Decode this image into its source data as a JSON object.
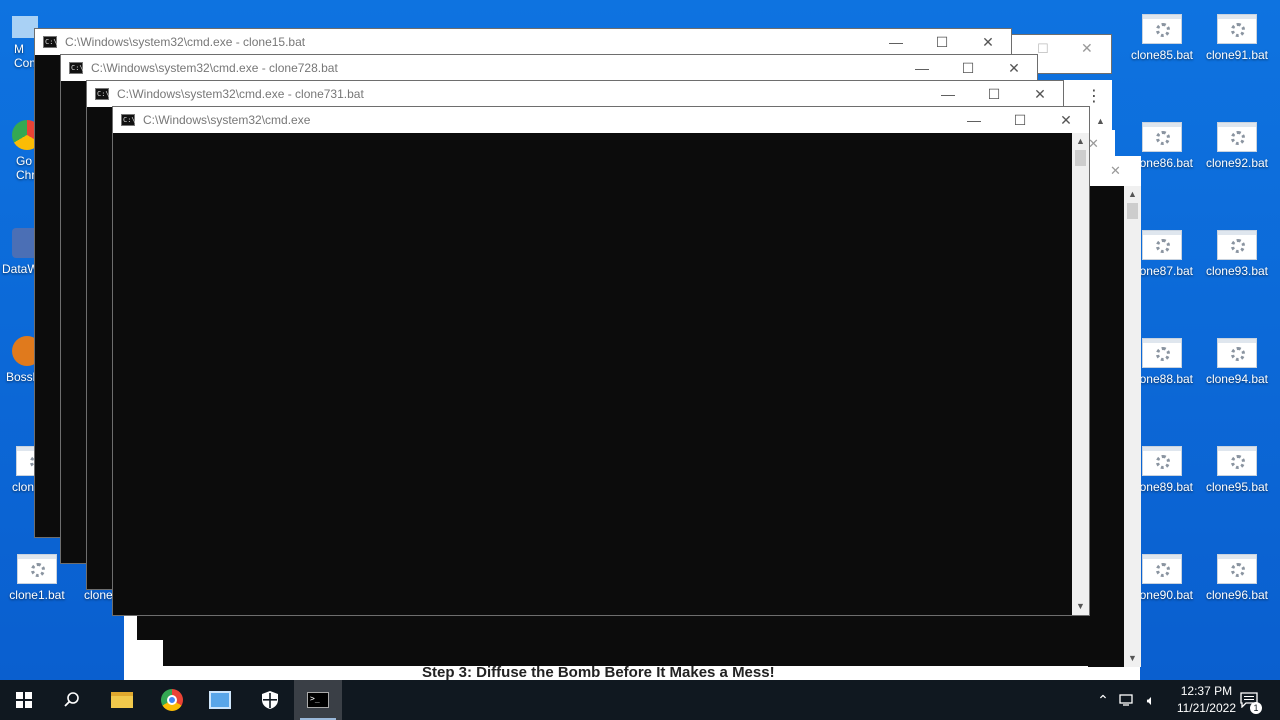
{
  "colors": {
    "desktop": "#0a66d6",
    "console": "#0c0c0c",
    "taskbar": "#101820"
  },
  "desktop_icons_right": [
    {
      "label": "clone85.bat"
    },
    {
      "label": "clone91.bat"
    },
    {
      "label": "clone86.bat"
    },
    {
      "label": "clone92.bat"
    },
    {
      "label": "clone87.bat"
    },
    {
      "label": "clone93.bat"
    },
    {
      "label": "clone88.bat"
    },
    {
      "label": "clone94.bat"
    },
    {
      "label": "clone89.bat"
    },
    {
      "label": "clone95.bat"
    },
    {
      "label": "clone90.bat"
    },
    {
      "label": "clone96.bat"
    }
  ],
  "desktop_icons_left": {
    "my_computer": "M\nCom",
    "chrome": "Go\nChr",
    "datawr": "DataW",
    "boss": "Bossl",
    "clon_partial": "clon",
    "clone1": "clone1.bat",
    "clone_partial": "clone"
  },
  "windows": [
    {
      "title": "C:\\Windows\\system32\\cmd.exe - clone15.bat"
    },
    {
      "title": "C:\\Windows\\system32\\cmd.exe - clone728.bat"
    },
    {
      "title": "C:\\Windows\\system32\\cmd.exe - clone731.bat"
    },
    {
      "title": "C:\\Windows\\system32\\cmd.exe"
    }
  ],
  "window_controls": {
    "minimize": "—",
    "maximize": "☐",
    "close": "✕"
  },
  "webpage": {
    "step_heading": "Step 3: Diffuse the Bomb Before It Makes a Mess!"
  },
  "taskbar": {
    "time": "12:37 PM",
    "date": "11/21/2022",
    "notification_count": "1"
  }
}
